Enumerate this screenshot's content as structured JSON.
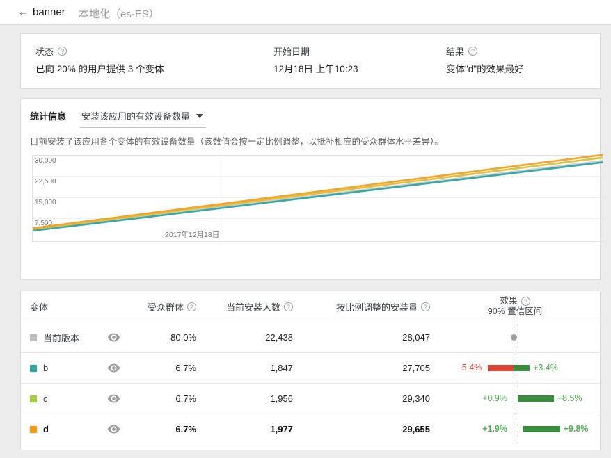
{
  "header": {
    "back_icon": "←",
    "title": "banner",
    "subtitle": "本地化（es-ES）"
  },
  "status_card": {
    "status_label": "状态",
    "status_value": "已向 20% 的用户提供 3 个变体",
    "start_label": "开始日期",
    "start_value": "12月18日 上午10:23",
    "result_label": "结果",
    "result_value": "变体\"d\"的效果最好"
  },
  "stats_card": {
    "title": "统计信息",
    "metric_dropdown": "安装该应用的有效设备数量",
    "description": "目前安装了该应用各个变体的有效设备数量（该数值会按一定比例调整，以抵补相应的受众群体水平差异）。"
  },
  "chart_data": {
    "type": "line",
    "title": "安装该应用的有效设备数量",
    "x_tick_labels": [
      "2017年12月18日"
    ],
    "y_ticks": [
      7500,
      15000,
      22500,
      30000
    ],
    "ylim": [
      0,
      30000
    ],
    "grid": true,
    "legend": "none",
    "series": [
      {
        "name": "当前版本",
        "color": "#cccccc",
        "start": 3300,
        "end": 28100
      },
      {
        "name": "b",
        "color": "#35a8a8",
        "start": 3000,
        "end": 27600
      },
      {
        "name": "c",
        "color": "#e0c040",
        "start": 3600,
        "end": 29300
      },
      {
        "name": "d",
        "color": "#f2a42c",
        "start": 3900,
        "end": 30300
      }
    ]
  },
  "table": {
    "col_variant": "变体",
    "col_audience": "受众群体",
    "col_installs": "当前安装人数",
    "col_adjusted": "按比例调整的安装量",
    "effect_header": {
      "line1": "效果",
      "line2": "90% 置信区间"
    },
    "rows": [
      {
        "name": "当前版本",
        "color": "#bdbdbd",
        "audience": "80.0%",
        "installs": "22,438",
        "adjusted": "28,047",
        "ci": null,
        "bold": false
      },
      {
        "name": "b",
        "color": "#2ba8a8",
        "audience": "6.7%",
        "installs": "1,847",
        "adjusted": "27,705",
        "ci": {
          "low": -5.4,
          "high": 3.4,
          "low_label": "-5.4%",
          "high_label": "+3.4%"
        },
        "bold": false
      },
      {
        "name": "c",
        "color": "#a6ce39",
        "audience": "6.7%",
        "installs": "1,956",
        "adjusted": "29,340",
        "ci": {
          "low": 0.9,
          "high": 8.5,
          "low_label": "+0.9%",
          "high_label": "+8.5%"
        },
        "bold": false
      },
      {
        "name": "d",
        "color": "#ff9800",
        "audience": "6.7%",
        "installs": "1,977",
        "adjusted": "29,655",
        "ci": {
          "low": 1.9,
          "high": 9.8,
          "low_label": "+1.9%",
          "high_label": "+9.8%"
        },
        "bold": true
      }
    ]
  },
  "colors": {
    "bar_negative": "#db4437",
    "bar_positive": "#388e3c",
    "label_negative": "#db4437",
    "label_positive": "#4caf50",
    "neutral_dot": "#9e9e9e"
  }
}
